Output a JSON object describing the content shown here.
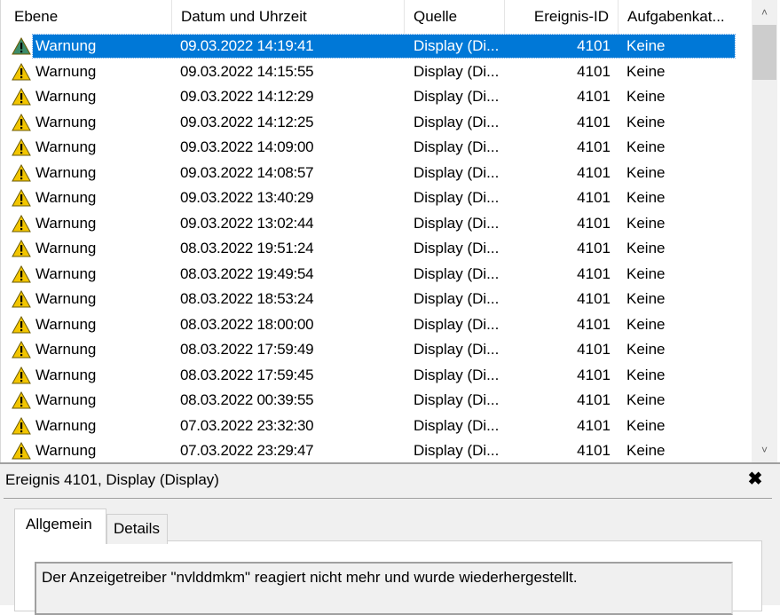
{
  "columns": {
    "level": "Ebene",
    "datetime": "Datum und Uhrzeit",
    "source": "Quelle",
    "event_id": "Ereignis-ID",
    "task_category": "Aufgabenkat..."
  },
  "rows": [
    {
      "level": "Warnung",
      "datetime": "09.03.2022 14:19:41",
      "source": "Display (Di...",
      "event_id": "4101",
      "task_category": "Keine",
      "selected": true
    },
    {
      "level": "Warnung",
      "datetime": "09.03.2022 14:15:55",
      "source": "Display (Di...",
      "event_id": "4101",
      "task_category": "Keine"
    },
    {
      "level": "Warnung",
      "datetime": "09.03.2022 14:12:29",
      "source": "Display (Di...",
      "event_id": "4101",
      "task_category": "Keine"
    },
    {
      "level": "Warnung",
      "datetime": "09.03.2022 14:12:25",
      "source": "Display (Di...",
      "event_id": "4101",
      "task_category": "Keine"
    },
    {
      "level": "Warnung",
      "datetime": "09.03.2022 14:09:00",
      "source": "Display (Di...",
      "event_id": "4101",
      "task_category": "Keine"
    },
    {
      "level": "Warnung",
      "datetime": "09.03.2022 14:08:57",
      "source": "Display (Di...",
      "event_id": "4101",
      "task_category": "Keine"
    },
    {
      "level": "Warnung",
      "datetime": "09.03.2022 13:40:29",
      "source": "Display (Di...",
      "event_id": "4101",
      "task_category": "Keine"
    },
    {
      "level": "Warnung",
      "datetime": "09.03.2022 13:02:44",
      "source": "Display (Di...",
      "event_id": "4101",
      "task_category": "Keine"
    },
    {
      "level": "Warnung",
      "datetime": "08.03.2022 19:51:24",
      "source": "Display (Di...",
      "event_id": "4101",
      "task_category": "Keine"
    },
    {
      "level": "Warnung",
      "datetime": "08.03.2022 19:49:54",
      "source": "Display (Di...",
      "event_id": "4101",
      "task_category": "Keine"
    },
    {
      "level": "Warnung",
      "datetime": "08.03.2022 18:53:24",
      "source": "Display (Di...",
      "event_id": "4101",
      "task_category": "Keine"
    },
    {
      "level": "Warnung",
      "datetime": "08.03.2022 18:00:00",
      "source": "Display (Di...",
      "event_id": "4101",
      "task_category": "Keine"
    },
    {
      "level": "Warnung",
      "datetime": "08.03.2022 17:59:49",
      "source": "Display (Di...",
      "event_id": "4101",
      "task_category": "Keine"
    },
    {
      "level": "Warnung",
      "datetime": "08.03.2022 17:59:45",
      "source": "Display (Di...",
      "event_id": "4101",
      "task_category": "Keine"
    },
    {
      "level": "Warnung",
      "datetime": "08.03.2022 00:39:55",
      "source": "Display (Di...",
      "event_id": "4101",
      "task_category": "Keine"
    },
    {
      "level": "Warnung",
      "datetime": "07.03.2022 23:32:30",
      "source": "Display (Di...",
      "event_id": "4101",
      "task_category": "Keine"
    },
    {
      "level": "Warnung",
      "datetime": "07.03.2022 23:29:47",
      "source": "Display (Di...",
      "event_id": "4101",
      "task_category": "Keine"
    }
  ],
  "icons": {
    "row_icon": "warning-icon",
    "close": "close-icon",
    "scroll_up": "chevron-up-icon",
    "scroll_down": "chevron-down-icon"
  },
  "colors": {
    "selection": "#0078d7",
    "warning_fill": "#f2c500",
    "selected_warning_fill": "#3c8c6a"
  },
  "details": {
    "title": "Ereignis 4101, Display (Display)",
    "close_label": "✖",
    "tabs": [
      "Allgemein",
      "Details"
    ],
    "description": "Der Anzeigetreiber \"nvlddmkm\" reagiert nicht mehr und wurde wiederhergestellt."
  }
}
